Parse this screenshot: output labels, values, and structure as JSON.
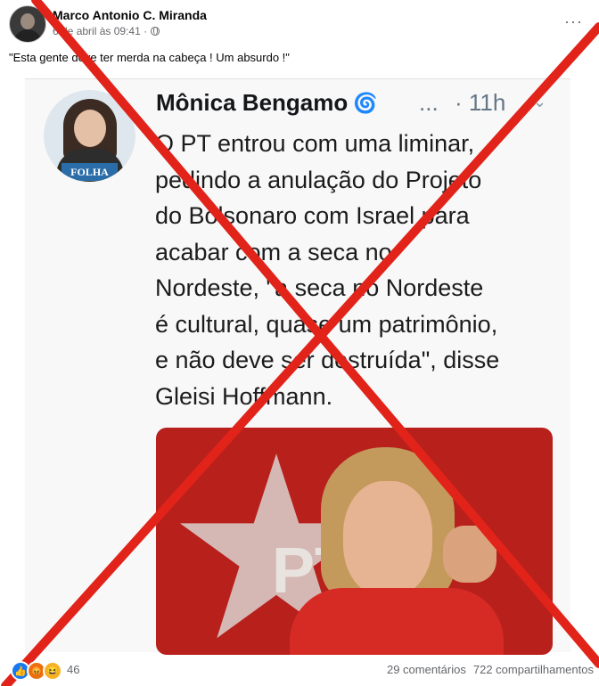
{
  "post": {
    "author": "Marco Antonio C. Miranda",
    "date": "6 de abril às 09:41 ·",
    "privacy_icon": "globe-icon",
    "more_icon": "more-options-icon",
    "more_symbol": "···",
    "caption": "\"Esta gente deve ter merda na cabeça ! Um absurdo !\""
  },
  "tweet": {
    "name": "Mônica Bengamo",
    "dots": "...",
    "time": "· 11h",
    "chevron": "⌄",
    "avatar_badge": "FOLHA",
    "text": "O PT entrou com uma liminar,\npedindo a anulação do Projeto\ndo Bolsonaro com Israel para\nacabar com a seca no\nNordeste, \"a seca no Nordeste\né cultural, quase um patrimônio,\ne não deve ser destruída\", disse\nGleisi Hoffmann.",
    "photo_text": "PT"
  },
  "footer": {
    "reaction_count": "46",
    "comments": "29 comentários",
    "shares": "722 compartilhamentos"
  },
  "colors": {
    "cross": "#e1231a",
    "like": "#1877f2",
    "angry": "#e9710f",
    "haha": "#f7b125"
  }
}
